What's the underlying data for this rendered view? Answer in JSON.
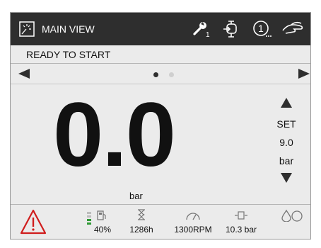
{
  "header": {
    "title": "MAIN VIEW",
    "icons": [
      "view-icon",
      "wrench-icon",
      "engine-icon",
      "alert-counter-icon",
      "hand-icon"
    ],
    "wrench_badge": "1",
    "counter_digit": "1"
  },
  "status": {
    "text": "READY TO START"
  },
  "nav": {
    "page_index": 0,
    "page_count": 2
  },
  "reading": {
    "value": "0.0",
    "unit": "bar"
  },
  "setpoint": {
    "label": "SET",
    "value": "9.0",
    "unit": "bar"
  },
  "bottom": {
    "warning_icon": "warning-triangle-icon",
    "fuel": {
      "level": "40%",
      "bars_filled": 2,
      "bars_total": 4
    },
    "hours": {
      "value": "1286h"
    },
    "rpm": {
      "value": "1300RPM"
    },
    "pressure": {
      "value": "10.3 bar"
    },
    "drops_icon": "drops-icon"
  },
  "colors": {
    "header_bg": "#2e2e2e",
    "panel_bg": "#ebebeb",
    "warning": "#d01d1d",
    "fuel_green": "#2f9a35"
  }
}
